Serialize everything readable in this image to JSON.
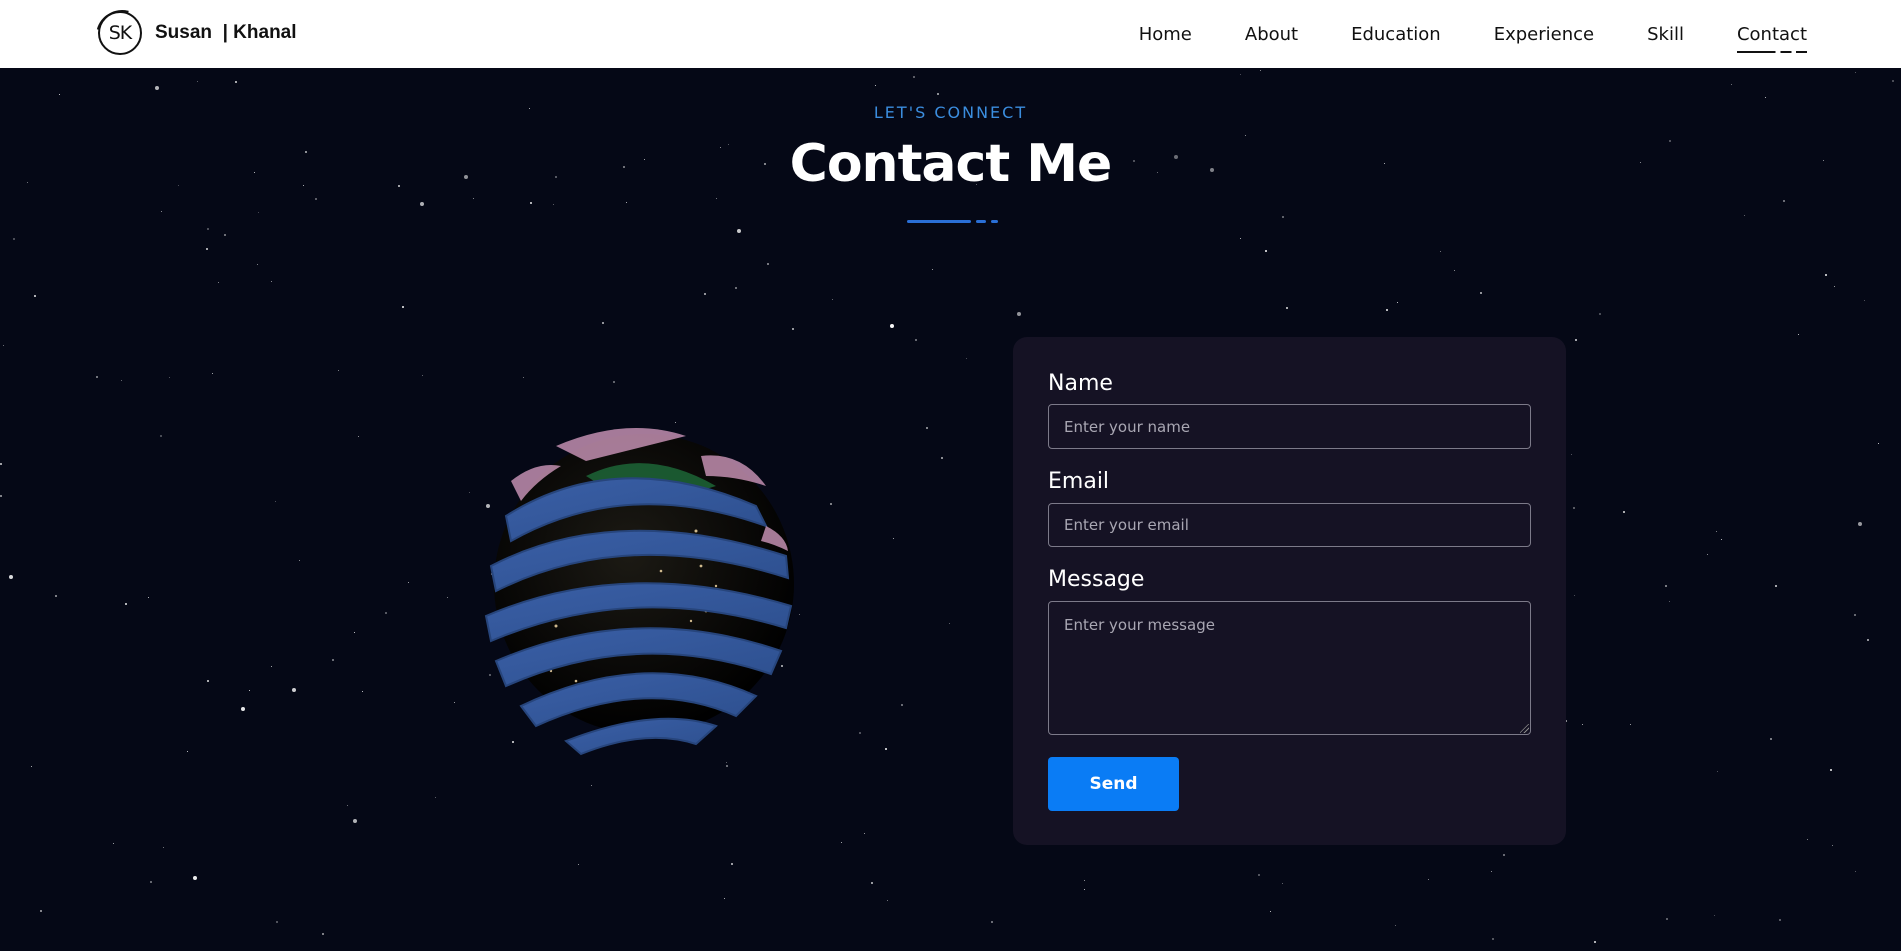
{
  "header": {
    "logo_text": "SK",
    "brand_name": "Susan  | Khanal",
    "nav": [
      {
        "label": "Home"
      },
      {
        "label": "About"
      },
      {
        "label": "Education"
      },
      {
        "label": "Experience"
      },
      {
        "label": "Skill"
      },
      {
        "label": "Contact",
        "active": true
      }
    ]
  },
  "section": {
    "eyebrow": "LET'S CONNECT",
    "title": "Contact Me"
  },
  "form": {
    "name_label": "Name",
    "name_placeholder": "Enter your name",
    "email_label": "Email",
    "email_placeholder": "Enter your email",
    "message_label": "Message",
    "message_placeholder": "Enter your message",
    "send_label": "Send"
  },
  "colors": {
    "background": "#050816",
    "card": "#151224",
    "accent": "#0a7cf5",
    "eyebrow": "#3b8dde"
  },
  "icons": {
    "globe": "3d-earth-globe"
  }
}
